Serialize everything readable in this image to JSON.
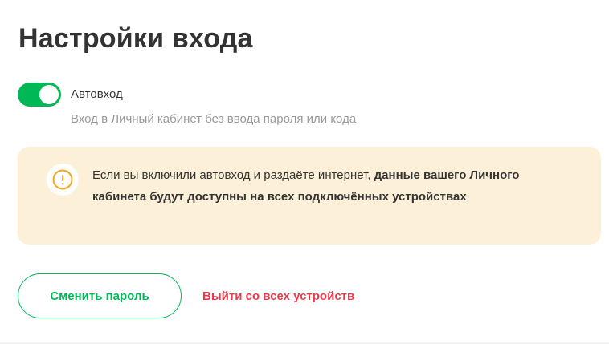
{
  "page": {
    "title": "Настройки входа"
  },
  "autologin": {
    "label": "Автовход",
    "description": "Вход в Личный кабинет без ввода пароля или кода",
    "enabled": true
  },
  "warning": {
    "text_regular": "Если вы включили автовход и раздаёте интернет, ",
    "text_bold": "данные вашего Личного кабинета будут доступны на всех подключённых устройствах",
    "icon": "exclamation-circle-icon"
  },
  "actions": {
    "change_password_label": "Сменить пароль",
    "logout_all_label": "Выйти со всех устройств"
  },
  "colors": {
    "accent": "#00b956",
    "danger": "#eb3b4a",
    "warning_bg": "#fdf0d8",
    "warning_icon": "#f5a623",
    "muted_text": "#999999"
  }
}
